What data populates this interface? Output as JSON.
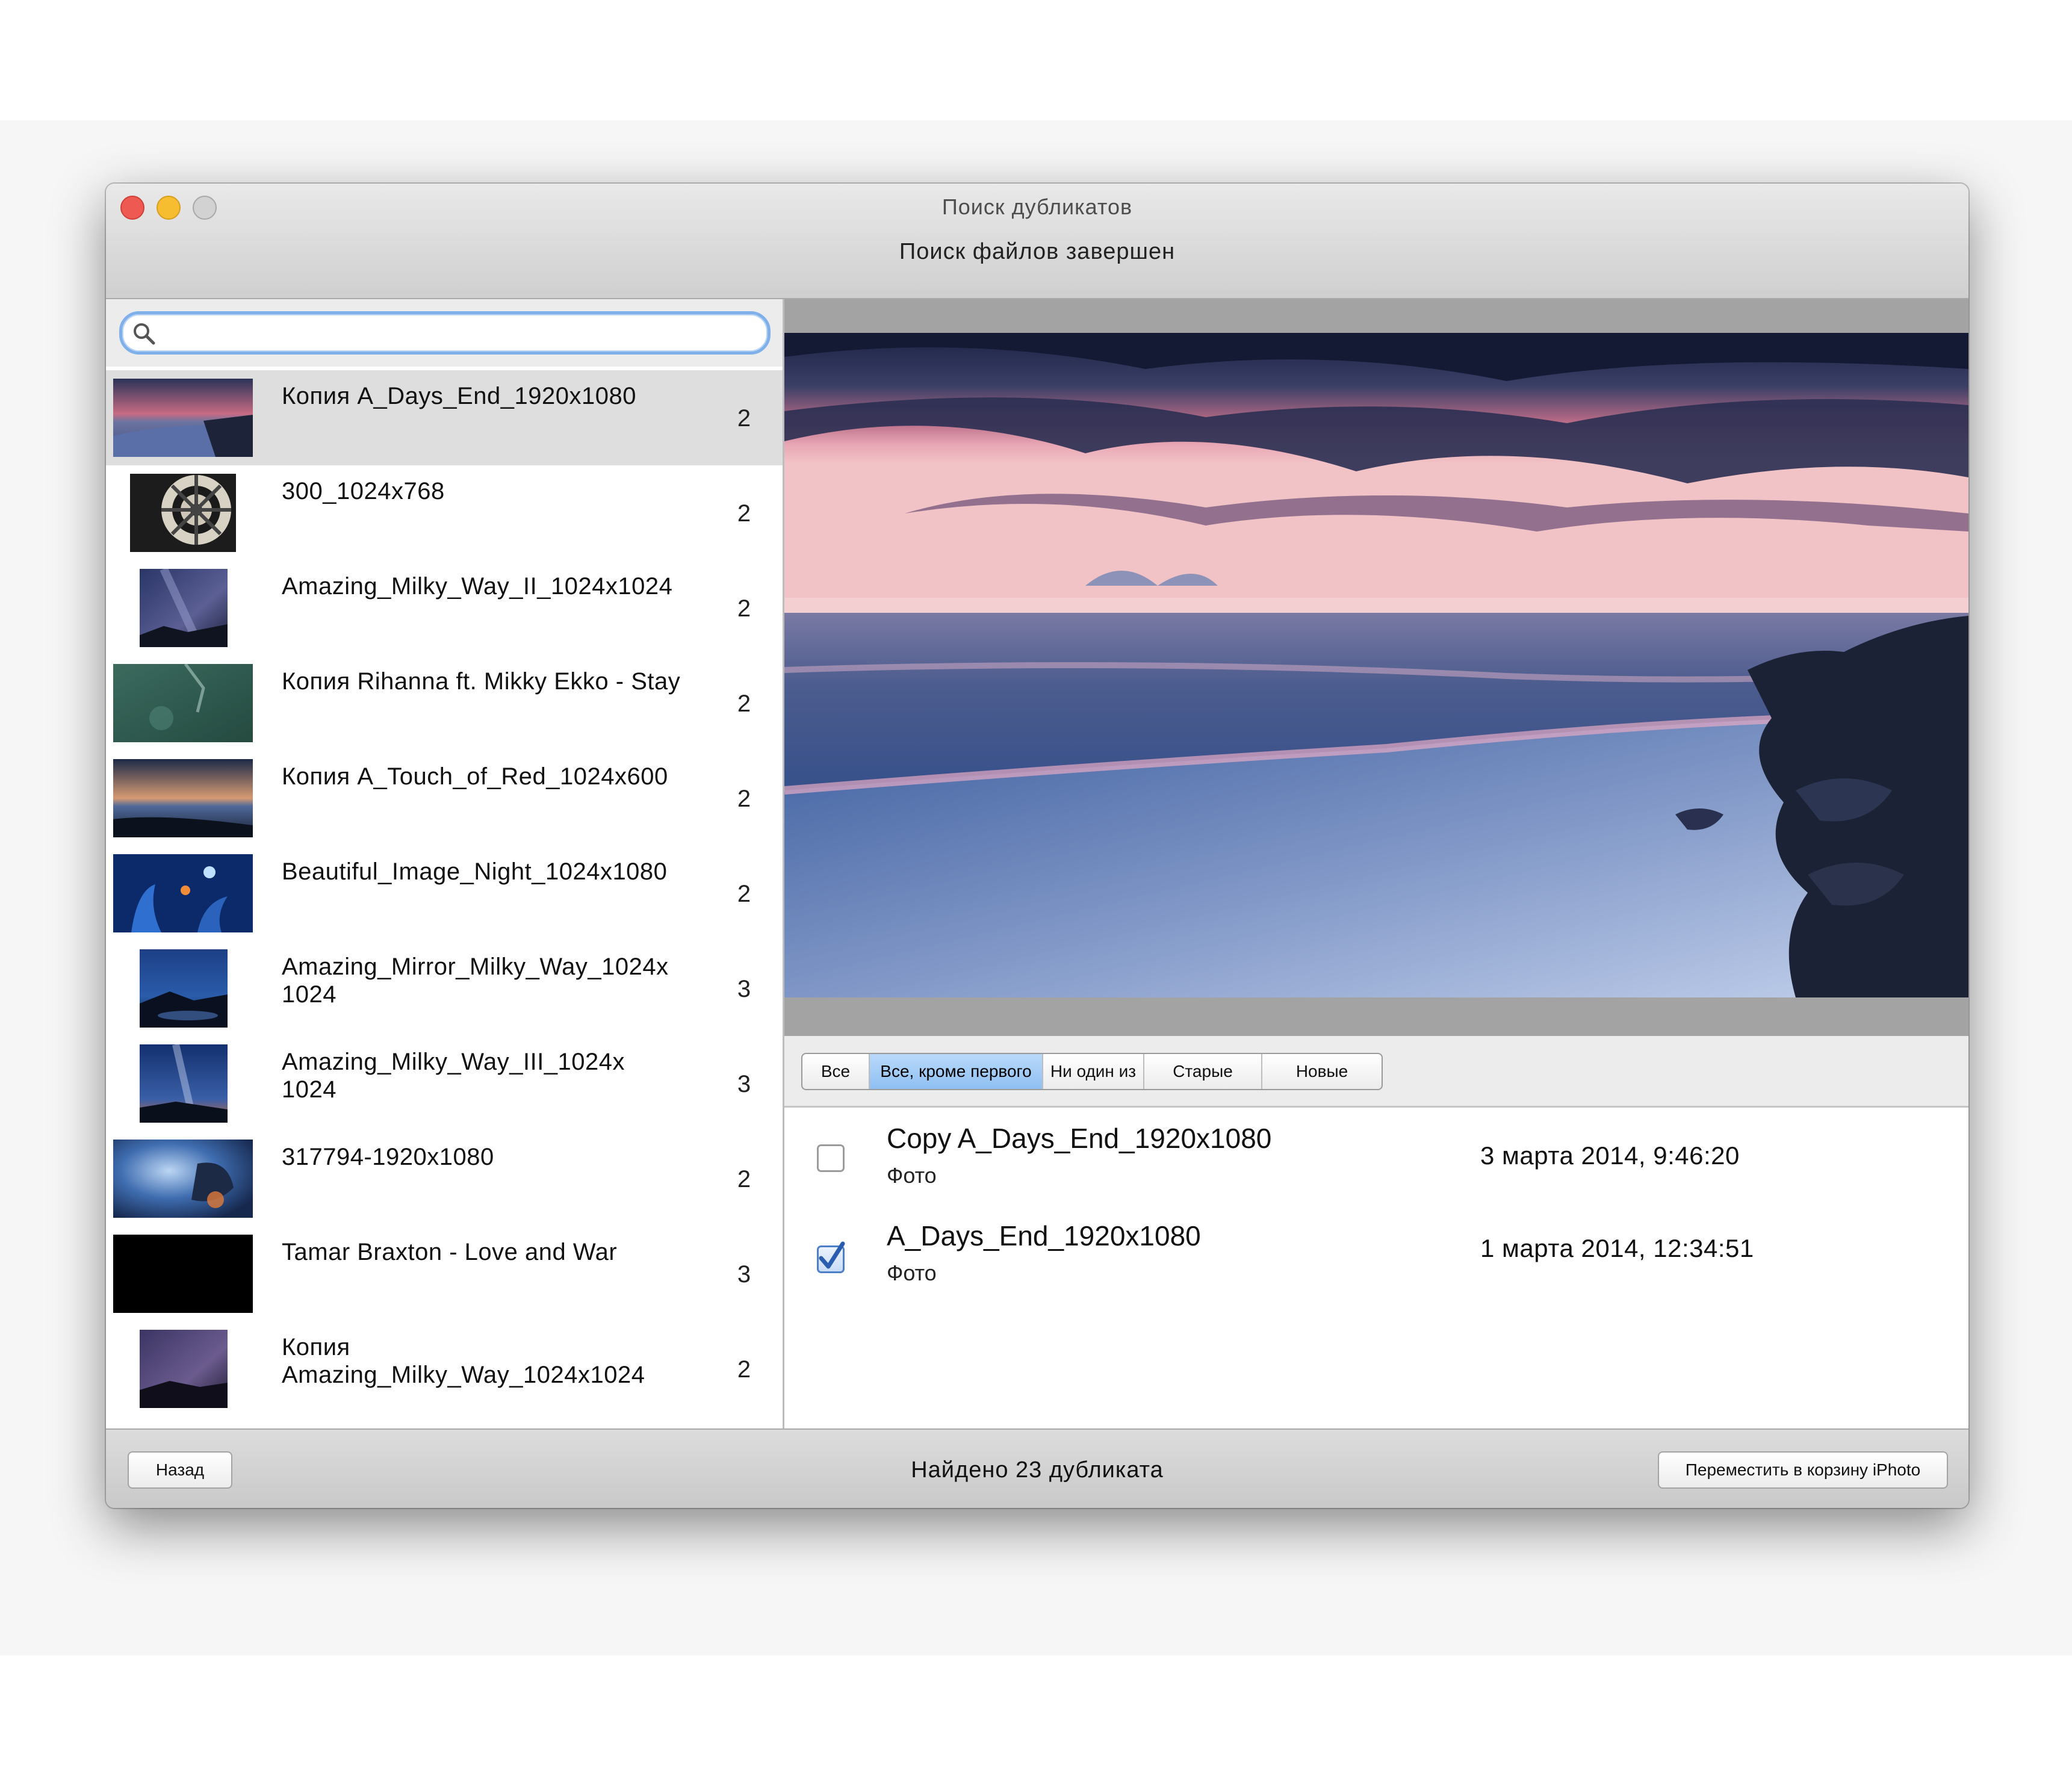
{
  "window": {
    "title": "Поиск дубликатов",
    "subtitle": "Поиск файлов завершен"
  },
  "search": {
    "value": "",
    "placeholder": ""
  },
  "duplicates": [
    {
      "name": "Копия A_Days_End_1920x1080",
      "count": "2",
      "thumb": "sunset-beach",
      "selected": true
    },
    {
      "name": "300_1024x768",
      "count": "2",
      "thumb": "dartboard"
    },
    {
      "name": "Amazing_Milky_Way_II_1024x1024",
      "count": "2",
      "thumb": "milky-way"
    },
    {
      "name": "Копия Rihanna ft. Mikky Ekko - Stay",
      "count": "2",
      "thumb": "green-water"
    },
    {
      "name": "Копия A_Touch_of_Red_1024x600",
      "count": "2",
      "thumb": "sea-sunset"
    },
    {
      "name": "Beautiful_Image_Night_1024x1080",
      "count": "2",
      "thumb": "night-blue"
    },
    {
      "name": "Amazing_Mirror_Milky_Way_1024x\n1024",
      "count": "3",
      "thumb": "mirror-milky-way"
    },
    {
      "name": "Amazing_Milky_Way_III_1024x\n1024",
      "count": "3",
      "thumb": "milky-way-orange"
    },
    {
      "name": "317794-1920x1080",
      "count": "2",
      "thumb": "fantasy-blue"
    },
    {
      "name": "Tamar Braxton - Love and War",
      "count": "3",
      "thumb": "black"
    },
    {
      "name": "Копия\nAmazing_Milky_Way_1024x1024",
      "count": "2",
      "thumb": "milky-way-purple"
    }
  ],
  "filter_buttons": [
    {
      "label": "Все",
      "active": false
    },
    {
      "label": "Все, кроме первого",
      "active": true
    },
    {
      "label": "Ни один из",
      "active": false
    },
    {
      "label": "Старые",
      "active": false
    },
    {
      "label": "Новые",
      "active": false
    }
  ],
  "files": [
    {
      "name": "Copy A_Days_End_1920x1080",
      "kind": "Фото",
      "date": "3 марта 2014, 9:46:20",
      "checked": false
    },
    {
      "name": "A_Days_End_1920x1080",
      "kind": "Фото",
      "date": "1 марта 2014, 12:34:51",
      "checked": true
    }
  ],
  "bottom": {
    "back_label": "Назад",
    "status": "Найдено 23 дубликата",
    "trash_label": "Переместить в корзину iPhoto"
  },
  "colors": {
    "selection": "#dedede",
    "segment_active": "#9cc7f5",
    "checkbox_accent": "#2a5db0"
  }
}
